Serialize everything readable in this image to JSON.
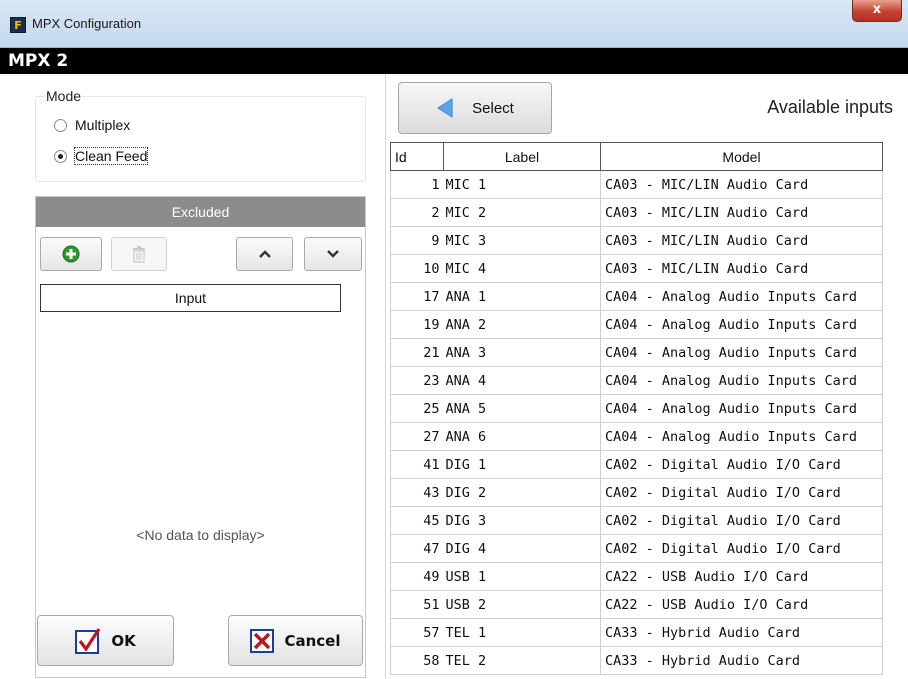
{
  "window": {
    "title": "MPX Configuration",
    "close_glyph": "x",
    "app_icon_letter": "F"
  },
  "header": {
    "title": "MPX 2"
  },
  "mode": {
    "legend": "Mode",
    "options": [
      {
        "label": "Multiplex",
        "selected": false
      },
      {
        "label": "Clean Feed",
        "selected": true
      }
    ]
  },
  "excluded": {
    "title": "Excluded",
    "toolbar": {
      "add_icon": "add-circle-icon",
      "delete_icon": "trash-icon",
      "move_up_icon": "chevron-up-icon",
      "move_down_icon": "chevron-down-icon",
      "delete_enabled": false
    },
    "column_header": "Input",
    "empty_text": "<No data to display>"
  },
  "footer": {
    "ok_label": "OK",
    "cancel_label": "Cancel"
  },
  "available": {
    "select_label": "Select",
    "title": "Available inputs",
    "columns": [
      "Id",
      "Label",
      "Model"
    ],
    "rows": [
      {
        "id": "1",
        "label": "MIC 1",
        "model": "CA03 - MIC/LIN Audio Card"
      },
      {
        "id": "2",
        "label": "MIC 2",
        "model": "CA03 - MIC/LIN Audio Card"
      },
      {
        "id": "9",
        "label": "MIC 3",
        "model": "CA03 - MIC/LIN Audio Card"
      },
      {
        "id": "10",
        "label": "MIC 4",
        "model": "CA03 - MIC/LIN Audio Card"
      },
      {
        "id": "17",
        "label": "ANA 1",
        "model": "CA04 - Analog Audio Inputs Card"
      },
      {
        "id": "19",
        "label": "ANA 2",
        "model": "CA04 - Analog Audio Inputs Card"
      },
      {
        "id": "21",
        "label": "ANA 3",
        "model": "CA04 - Analog Audio Inputs Card"
      },
      {
        "id": "23",
        "label": "ANA 4",
        "model": "CA04 - Analog Audio Inputs Card"
      },
      {
        "id": "25",
        "label": "ANA 5",
        "model": "CA04 - Analog Audio Inputs Card"
      },
      {
        "id": "27",
        "label": "ANA 6",
        "model": "CA04 - Analog Audio Inputs Card"
      },
      {
        "id": "41",
        "label": "DIG 1",
        "model": "CA02 - Digital Audio I/O Card"
      },
      {
        "id": "43",
        "label": "DIG 2",
        "model": "CA02 - Digital Audio I/O Card"
      },
      {
        "id": "45",
        "label": "DIG 3",
        "model": "CA02 - Digital Audio I/O Card"
      },
      {
        "id": "47",
        "label": "DIG 4",
        "model": "CA02 - Digital Audio I/O Card"
      },
      {
        "id": "49",
        "label": "USB 1",
        "model": "CA22 - USB Audio I/O Card"
      },
      {
        "id": "51",
        "label": "USB 2",
        "model": "CA22 - USB Audio I/O Card"
      },
      {
        "id": "57",
        "label": "TEL 1",
        "model": "CA33 - Hybrid Audio Card"
      },
      {
        "id": "58",
        "label": "TEL 2",
        "model": "CA33 - Hybrid Audio Card"
      }
    ]
  },
  "colors": {
    "header_bar": "#000000",
    "excluded_header": "#8c8c8c",
    "add_icon": "#2e9a2e",
    "ok_check": "#c0141c",
    "cancel_x": "#c0141c",
    "select_arrow": "#5aa6e6"
  }
}
